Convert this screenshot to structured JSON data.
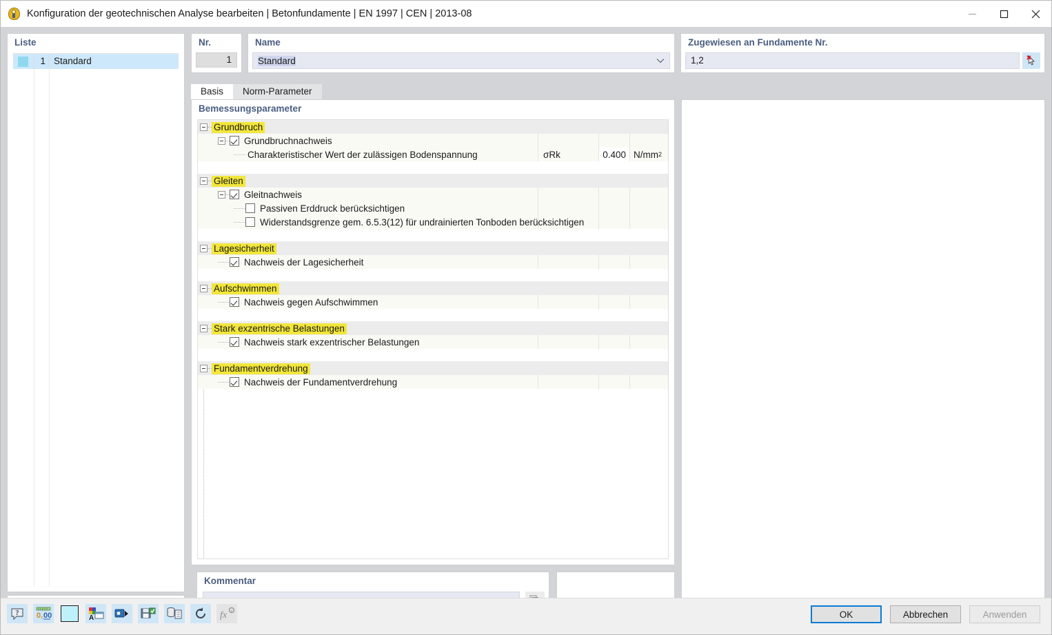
{
  "window": {
    "title": "Konfiguration der geotechnischen Analyse bearbeiten | Betonfundamente | EN 1997 | CEN | 2013-08",
    "app_icon": "magnifier-yellow-icon",
    "minimize": "minimize-icon",
    "maximize": "maximize-icon",
    "close": "close-icon"
  },
  "list": {
    "caption": "Liste",
    "rows": [
      {
        "swatch_color": "#8fd8f0",
        "nr": "1",
        "name": "Standard"
      }
    ],
    "toolbar": [
      {
        "name": "new-item-button",
        "icon": "new-window-star-icon",
        "enabled": true
      },
      {
        "name": "duplicate-item-button",
        "icon": "copy-window-icon",
        "enabled": true
      },
      {
        "name": "check-all-button",
        "icon": "check-all-icon",
        "enabled": false
      },
      {
        "name": "invert-check-button",
        "icon": "toggle-check-icon",
        "enabled": false
      },
      {
        "name": "delete-item-button",
        "icon": "red-x-icon",
        "enabled": true
      }
    ]
  },
  "number_field": {
    "caption": "Nr.",
    "value": "1"
  },
  "name_field": {
    "caption": "Name",
    "value": "Standard",
    "chevron": "chevron-down-icon"
  },
  "assigned": {
    "caption": "Zugewiesen an Fundamente Nr.",
    "value": "1,2",
    "pick_icon": "select-cursor-red-x-icon"
  },
  "tabs": [
    {
      "label": "Basis",
      "active": true
    },
    {
      "label": "Norm-Parameter",
      "active": false
    }
  ],
  "parameters": {
    "caption": "Bemessungsparameter",
    "columns": {
      "symbol": "",
      "value": "",
      "unit": ""
    },
    "groups": [
      {
        "label": "Grundbruch",
        "rows": [
          {
            "kind": "check",
            "label": "Grundbruchnachweis",
            "checked": true,
            "expander": true,
            "symbol": "",
            "value": "",
            "unit": ""
          },
          {
            "kind": "value",
            "label": "Charakteristischer Wert der zulässigen Bodenspannung",
            "symbol": "σRk",
            "value": "0.400",
            "unit": "N/mm",
            "unit_sup": "2"
          }
        ]
      },
      {
        "label": "Gleiten",
        "rows": [
          {
            "kind": "check",
            "label": "Gleitnachweis",
            "checked": true,
            "expander": true,
            "symbol": "",
            "value": "",
            "unit": ""
          },
          {
            "kind": "check",
            "label": "Passiven Erddruck berücksichtigen",
            "checked": false,
            "expander": false,
            "indent": 2,
            "symbol": "",
            "value": "",
            "unit": ""
          },
          {
            "kind": "check",
            "label": "Widerstandsgrenze gem. 6.5.3(12) für undrainierten Tonboden berücksichtigen",
            "checked": false,
            "expander": false,
            "indent": 2,
            "symbol": "",
            "value": "",
            "unit": ""
          }
        ]
      },
      {
        "label": "Lagesicherheit",
        "rows": [
          {
            "kind": "check",
            "label": "Nachweis der Lagesicherheit",
            "checked": true,
            "expander": false,
            "symbol": "",
            "value": "",
            "unit": ""
          }
        ]
      },
      {
        "label": "Aufschwimmen",
        "rows": [
          {
            "kind": "check",
            "label": "Nachweis gegen Aufschwimmen",
            "checked": true,
            "expander": false,
            "symbol": "",
            "value": "",
            "unit": ""
          }
        ]
      },
      {
        "label": "Stark exzentrische Belastungen",
        "rows": [
          {
            "kind": "check",
            "label": "Nachweis stark exzentrischer Belastungen",
            "checked": true,
            "expander": false,
            "symbol": "",
            "value": "",
            "unit": ""
          }
        ]
      },
      {
        "label": "Fundamentverdrehung",
        "rows": [
          {
            "kind": "check",
            "label": "Nachweis der Fundamentverdrehung",
            "checked": true,
            "expander": false,
            "symbol": "",
            "value": "",
            "unit": ""
          }
        ]
      }
    ]
  },
  "comment": {
    "caption": "Kommentar",
    "value": "",
    "chevron": "chevron-down-icon",
    "copy_icon": "copy-pages-icon"
  },
  "bottom_toolbar": [
    {
      "name": "help-button",
      "icon": "question-bubble-icon",
      "enabled": true
    },
    {
      "name": "decimal-places-button",
      "icon": "decimal-0-00-icon",
      "enabled": true
    },
    {
      "name": "color-swatch-button",
      "icon": "color-swatch-icon",
      "enabled": true,
      "color": "#bff1fb"
    },
    {
      "name": "units-format-button",
      "icon": "units-letter-a-icon",
      "enabled": true
    },
    {
      "name": "export-button",
      "icon": "export-arrow-icon",
      "enabled": true
    },
    {
      "name": "save-config-button",
      "icon": "save-green-icon",
      "enabled": true
    },
    {
      "name": "database-button",
      "icon": "database-document-icon",
      "enabled": true
    },
    {
      "name": "reset-button",
      "icon": "undo-circular-arrow-icon",
      "enabled": true
    },
    {
      "name": "formula-button",
      "icon": "fx-formula-icon",
      "enabled": false
    }
  ],
  "dialog_buttons": {
    "ok": "OK",
    "cancel": "Abbrechen",
    "apply": "Anwenden"
  },
  "colors": {
    "accent_blue": "#0a7bd4",
    "highlight_yellow": "#f2e63c",
    "selection_blue": "#cde8fb",
    "field_lavender": "#e6e8f2"
  }
}
